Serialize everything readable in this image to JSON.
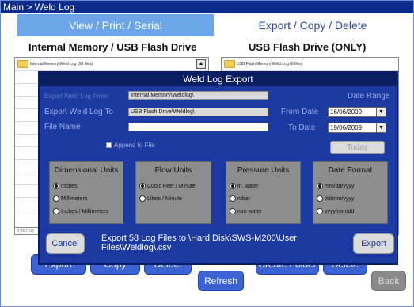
{
  "titlebar": {
    "breadcrumb": "Main > Weld Log"
  },
  "tabs": {
    "left": "View / Print / Serial",
    "right": "Export / Copy / Delete"
  },
  "headers": {
    "left": "Internal Memory / USB Flash Drive",
    "right": "USB Flash Drive (ONLY)"
  },
  "panes": {
    "left_path": "Internal Memory\\Weld Log (58 files)",
    "right_path": "USB Flash Memory\\Weld Log (0 files)",
    "bottom_strip": "Interna"
  },
  "bottom_buttons": {
    "export": "Export",
    "copy": "Copy",
    "delete": "Delete",
    "create_folder": "Create Folder",
    "delete2": "Delete",
    "refresh": "Refresh",
    "back": "Back"
  },
  "dialog": {
    "title": "Weld Log Export",
    "export_from_label": "Export Weld Log From",
    "export_from_value": "Internal Memory\\Weldlog\\",
    "export_to_label": "Export Weld Log To",
    "export_to_value": "USB Flash Drive\\Weldlog\\",
    "file_name_label": "File Name",
    "file_name_value": "",
    "append_label": "Append to File",
    "date_range_label": "Date Range",
    "from_date_label": "From Date",
    "from_date_value": "16/06/2009",
    "to_date_label": "To Date",
    "to_date_value": "19/06/2009",
    "today_button": "Today",
    "groups": {
      "dimensional": {
        "title": "Dimensional Units",
        "options": [
          "Inches",
          "Millimeters",
          "Inches / Millimeters"
        ],
        "selected": 0
      },
      "flow": {
        "title": "Flow Units",
        "options": [
          "Cubic Feet / Minute",
          "Liters / Minute"
        ],
        "selected": 0
      },
      "pressure": {
        "title": "Pressure Units",
        "options": [
          "in. water",
          "mbar",
          "mm water"
        ],
        "selected": 0
      },
      "date": {
        "title": "Date Format",
        "options": [
          "mm/dd/yyyy",
          "dd/mm/yyyy",
          "yyyy/mm/dd"
        ],
        "selected": 0
      }
    },
    "cancel_button": "Cancel",
    "export_button": "Export",
    "status_message": "Export 58 Log Files to \\Hard Disk\\SWS-M200\\User Files\\Weldlog\\.csv"
  },
  "colors": {
    "dialog_bg": "#1c3aa1",
    "titlebar": "#0a2a8c",
    "tab_active": "#6aa6e8",
    "button": "#3c63d3"
  },
  "icons": {
    "folder": "folder-icon",
    "scroll": "scroll-up-icon",
    "dropdown": "chevron-down-icon"
  }
}
